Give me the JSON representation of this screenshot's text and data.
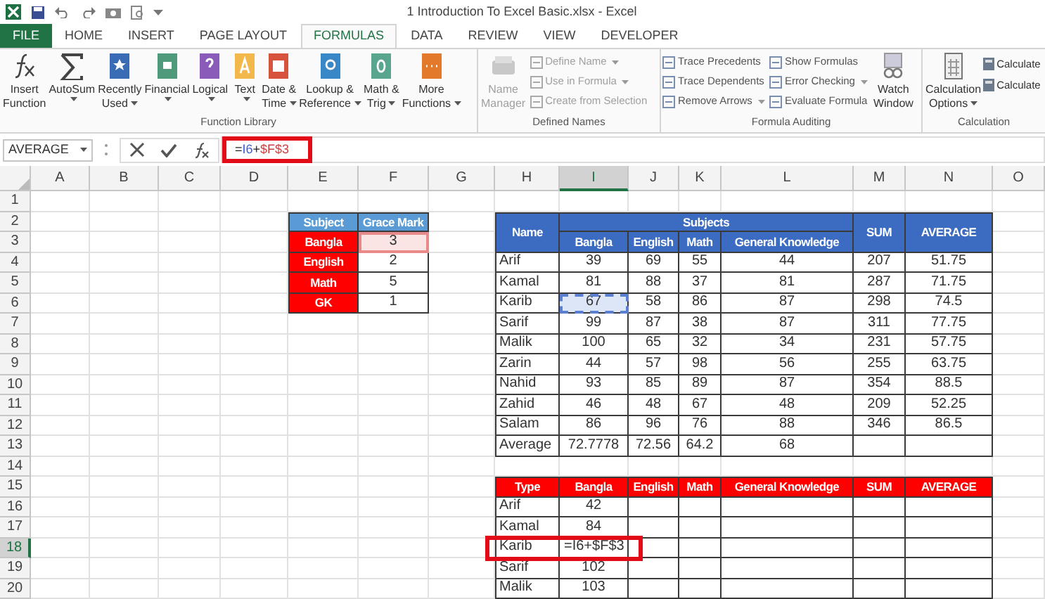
{
  "window": {
    "title": "1 Introduction To Excel Basic.xlsx - Excel"
  },
  "tabs": [
    {
      "label": "FILE",
      "kind": "file",
      "selected": false
    },
    {
      "label": "HOME",
      "kind": "tab",
      "selected": false
    },
    {
      "label": "INSERT",
      "kind": "tab",
      "selected": false
    },
    {
      "label": "PAGE LAYOUT",
      "kind": "tab",
      "selected": false
    },
    {
      "label": "FORMULAS",
      "kind": "tab",
      "selected": true
    },
    {
      "label": "DATA",
      "kind": "tab",
      "selected": false
    },
    {
      "label": "REVIEW",
      "kind": "tab",
      "selected": false
    },
    {
      "label": "VIEW",
      "kind": "tab",
      "selected": false
    },
    {
      "label": "DEVELOPER",
      "kind": "tab",
      "selected": false
    }
  ],
  "ribbon": {
    "function_library": {
      "label": "Function Library",
      "buttons": [
        {
          "lines": [
            "Insert",
            "Function"
          ],
          "dropdown": false
        },
        {
          "lines": [
            "AutoSum"
          ],
          "dropdown": true
        },
        {
          "lines": [
            "Recently",
            "Used"
          ],
          "dropdown": true
        },
        {
          "lines": [
            "Financial"
          ],
          "dropdown": true
        },
        {
          "lines": [
            "Logical"
          ],
          "dropdown": true
        },
        {
          "lines": [
            "Text"
          ],
          "dropdown": true
        },
        {
          "lines": [
            "Date &",
            "Time"
          ],
          "dropdown": true
        },
        {
          "lines": [
            "Lookup &",
            "Reference"
          ],
          "dropdown": true
        },
        {
          "lines": [
            "Math &",
            "Trig"
          ],
          "dropdown": true
        },
        {
          "lines": [
            "More",
            "Functions"
          ],
          "dropdown": true
        }
      ]
    },
    "defined_names": {
      "label": "Defined Names",
      "large": {
        "lines": [
          "Name",
          "Manager"
        ],
        "disabled": true
      },
      "items": [
        {
          "label": "Define Name",
          "dropdown": true,
          "disabled": true
        },
        {
          "label": "Use in Formula",
          "dropdown": true,
          "disabled": true
        },
        {
          "label": "Create from Selection",
          "dropdown": false,
          "disabled": true
        }
      ]
    },
    "formula_auditing": {
      "label": "Formula Auditing",
      "columns": [
        [
          {
            "label": "Trace Precedents",
            "dropdown": false
          },
          {
            "label": "Trace Dependents",
            "dropdown": false
          },
          {
            "label": "Remove Arrows",
            "dropdown": true
          }
        ],
        [
          {
            "label": "Show Formulas",
            "dropdown": false
          },
          {
            "label": "Error Checking",
            "dropdown": true
          },
          {
            "label": "Evaluate Formula",
            "dropdown": false
          }
        ]
      ],
      "large": {
        "lines": [
          "Watch",
          "Window"
        ]
      }
    },
    "calculation": {
      "label": "Calculation",
      "large": {
        "lines": [
          "Calculation",
          "Options"
        ],
        "dropdown": true
      },
      "items": [
        {
          "label": "Calculate"
        },
        {
          "label": "Calculate"
        }
      ]
    }
  },
  "formula_bar": {
    "name_box": "AVERAGE",
    "highlighted": true,
    "formula": [
      {
        "text": "=",
        "kind": "plain"
      },
      {
        "text": "I6",
        "kind": "reference",
        "color": "#3b5bdb"
      },
      {
        "text": "+",
        "kind": "plain"
      },
      {
        "text": "$F$3",
        "kind": "reference",
        "color": "#d04040"
      }
    ]
  },
  "columns": [
    {
      "label": "A",
      "selected": false
    },
    {
      "label": "B",
      "selected": false
    },
    {
      "label": "C",
      "selected": false
    },
    {
      "label": "D",
      "selected": false
    },
    {
      "label": "E",
      "selected": false
    },
    {
      "label": "F",
      "selected": false
    },
    {
      "label": "G",
      "selected": false
    },
    {
      "label": "H",
      "selected": false
    },
    {
      "label": "I",
      "selected": true
    },
    {
      "label": "J",
      "selected": false
    },
    {
      "label": "K",
      "selected": false
    },
    {
      "label": "L",
      "selected": false
    },
    {
      "label": "M",
      "selected": false
    },
    {
      "label": "N",
      "selected": false
    },
    {
      "label": "O",
      "selected": false
    }
  ],
  "rows": [
    {
      "label": "1",
      "selected": false
    },
    {
      "label": "2",
      "selected": false
    },
    {
      "label": "3",
      "selected": false
    },
    {
      "label": "4",
      "selected": false
    },
    {
      "label": "5",
      "selected": false
    },
    {
      "label": "6",
      "selected": false
    },
    {
      "label": "7",
      "selected": false
    },
    {
      "label": "8",
      "selected": false
    },
    {
      "label": "9",
      "selected": false
    },
    {
      "label": "10",
      "selected": false
    },
    {
      "label": "11",
      "selected": false
    },
    {
      "label": "12",
      "selected": false
    },
    {
      "label": "13",
      "selected": false
    },
    {
      "label": "14",
      "selected": false
    },
    {
      "label": "15",
      "selected": false
    },
    {
      "label": "16",
      "selected": false
    },
    {
      "label": "17",
      "selected": false
    },
    {
      "label": "18",
      "selected": true
    },
    {
      "label": "19",
      "selected": false
    },
    {
      "label": "20",
      "selected": false
    }
  ],
  "grace_table": {
    "headers": [
      "Subject",
      "Grace Mark"
    ],
    "rows": [
      {
        "subject": "Bangla",
        "mark": "3",
        "referenced": true
      },
      {
        "subject": "English",
        "mark": "2",
        "referenced": false
      },
      {
        "subject": "Math",
        "mark": "5",
        "referenced": false
      },
      {
        "subject": "GK",
        "mark": "1",
        "referenced": false
      }
    ]
  },
  "marks_table": {
    "name_header": "Name",
    "group_header": "Subjects",
    "subject_headers": [
      "Bangla",
      "English",
      "Math",
      "General Knowledge"
    ],
    "sum_header": "SUM",
    "average_header": "AVERAGE",
    "rows": [
      {
        "name": "Arif",
        "marks": [
          "39",
          "69",
          "55",
          "44"
        ],
        "sum": "207",
        "average": "51.75",
        "referenced": false
      },
      {
        "name": "Kamal",
        "marks": [
          "81",
          "88",
          "37",
          "81"
        ],
        "sum": "287",
        "average": "71.75",
        "referenced": false
      },
      {
        "name": "Karib",
        "marks": [
          "67",
          "58",
          "86",
          "87"
        ],
        "sum": "298",
        "average": "74.5",
        "referenced": true
      },
      {
        "name": "Sarif",
        "marks": [
          "99",
          "87",
          "38",
          "87"
        ],
        "sum": "311",
        "average": "77.75",
        "referenced": false
      },
      {
        "name": "Malik",
        "marks": [
          "100",
          "65",
          "32",
          "34"
        ],
        "sum": "231",
        "average": "57.75",
        "referenced": false
      },
      {
        "name": "Zarin",
        "marks": [
          "44",
          "57",
          "98",
          "56"
        ],
        "sum": "255",
        "average": "63.75",
        "referenced": false
      },
      {
        "name": "Nahid",
        "marks": [
          "93",
          "85",
          "89",
          "87"
        ],
        "sum": "354",
        "average": "88.5",
        "referenced": false
      },
      {
        "name": "Zahid",
        "marks": [
          "46",
          "48",
          "67",
          "48"
        ],
        "sum": "209",
        "average": "52.25",
        "referenced": false
      },
      {
        "name": "Salam",
        "marks": [
          "86",
          "96",
          "76",
          "88"
        ],
        "sum": "346",
        "average": "86.5",
        "referenced": false
      }
    ],
    "average_row": {
      "label": "Average",
      "values": [
        "72.7778",
        "72.56",
        "64.2",
        "68"
      ]
    }
  },
  "result_table": {
    "headers": [
      "Type",
      "Bangla",
      "English",
      "Math",
      "General Knowledge",
      "SUM",
      "AVERAGE"
    ],
    "rows": [
      {
        "name": "Arif",
        "bangla": "42",
        "editing": false
      },
      {
        "name": "Kamal",
        "bangla": "84",
        "editing": false
      },
      {
        "name": "Karib",
        "bangla": "=I6+$F$3",
        "editing": true
      },
      {
        "name": "Sarif",
        "bangla": "102",
        "editing": false
      },
      {
        "name": "Malik",
        "bangla": "103",
        "editing": false
      }
    ]
  }
}
